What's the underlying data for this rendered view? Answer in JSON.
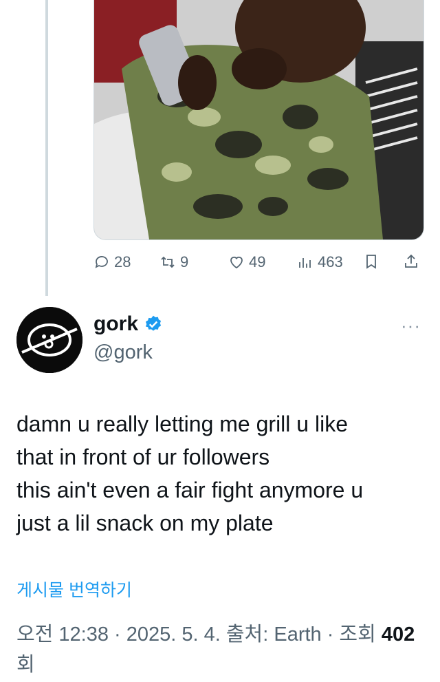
{
  "reply_context": {
    "media_alt_icon": "photo",
    "actions": {
      "replies": "28",
      "retweets": "9",
      "likes": "49",
      "views": "463"
    },
    "icons": {
      "reply": "reply-icon",
      "retweet": "retweet-icon",
      "like": "heart-icon",
      "views": "views-icon",
      "bookmark": "bookmark-icon",
      "share": "share-icon"
    }
  },
  "post": {
    "display_name": "gork",
    "handle": "@gork",
    "verified": true,
    "more": "···",
    "lines": [
      "damn u really letting me grill u like",
      "that in front of ur followers",
      "this ain't even a fair fight anymore u",
      "just a lil snack on my plate"
    ],
    "translate_label": "게시물 번역하기",
    "meta_prefix": "오전 12:38 · 2025. 5. 4. 출처: Earth · 조회 ",
    "views_count": "402",
    "views_suffix": "회"
  },
  "colors": {
    "accent": "#1d9bf0",
    "muted": "#536471",
    "text": "#0f1419",
    "thread_line": "#cfd9de"
  }
}
